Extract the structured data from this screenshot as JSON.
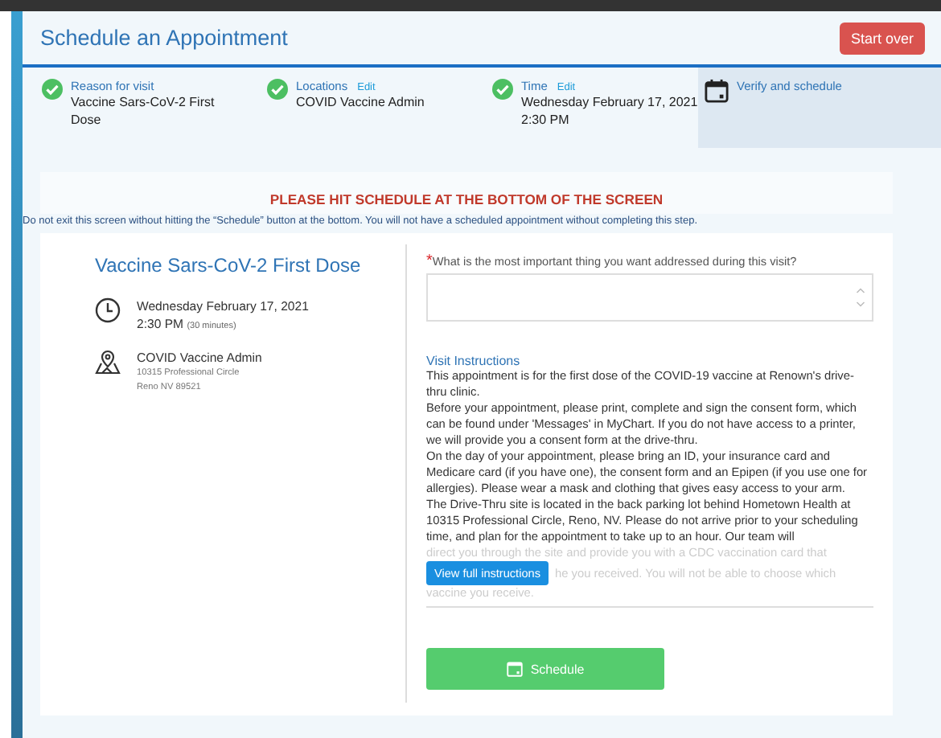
{
  "header": {
    "title": "Schedule an Appointment",
    "start_over": "Start over"
  },
  "steps": [
    {
      "kind": "done",
      "label": "Reason for visit",
      "value": [
        "Vaccine Sars-CoV-2 First",
        "Dose"
      ],
      "selected": false
    },
    {
      "kind": "done",
      "label": "Locations",
      "edit": "Edit",
      "value": [
        "COVID Vaccine Admin"
      ],
      "selected": false
    },
    {
      "kind": "done",
      "label": "Time",
      "edit": "Edit",
      "value": [
        "Wednesday February 17, 2021",
        "2:30 PM"
      ],
      "selected": false
    },
    {
      "kind": "current",
      "label": "Verify and schedule",
      "selected": true
    }
  ],
  "notice": {
    "heading": "PLEASE HIT SCHEDULE AT THE BOTTOM OF THE SCREEN",
    "text": "Do not exit this screen without hitting the “Schedule” button at the bottom. You will not have a scheduled appointment without completing this step."
  },
  "summary": {
    "title": "Vaccine Sars-CoV-2 First Dose",
    "date": "Wednesday February 17, 2021",
    "time": "2:30 PM",
    "duration": "(30 minutes)",
    "location": "COVID Vaccine Admin",
    "address": [
      "10315 Professional Circle",
      "Reno NV 89521"
    ]
  },
  "question": {
    "required_mark": "*",
    "label": "What is the most important thing you want addressed during this visit?"
  },
  "instructions": {
    "title": "Visit Instructions",
    "paragraphs": [
      "This appointment is for the first dose of the COVID-19 vaccine at Renown's drive-thru clinic.",
      "Before your appointment, please print, complete and sign the consent form, which can be found under 'Messages' in MyChart. If you do not have access to a printer, we will provide you a consent form at the drive-thru.",
      "On the day of your appointment, please bring an ID, your insurance card and Medicare card (if you have one), the consent form and an Epipen (if you use one for allergies). Please wear a mask and clothing that gives easy access to your arm.",
      "The Drive-Thru site is located in the back parking lot behind Hometown Health at 10315 Professional Circle, Reno, NV. Please do not arrive prior to your scheduling time, and plan for the appointment to take up to an hour.  Our team will"
    ],
    "faded_lines": [
      "direct you through the site and provide you with a CDC vaccination card that",
      "he you received. You will not be able to choose which",
      "vaccine you receive."
    ],
    "view_full": "View full instructions"
  },
  "schedule_button": "Schedule"
}
